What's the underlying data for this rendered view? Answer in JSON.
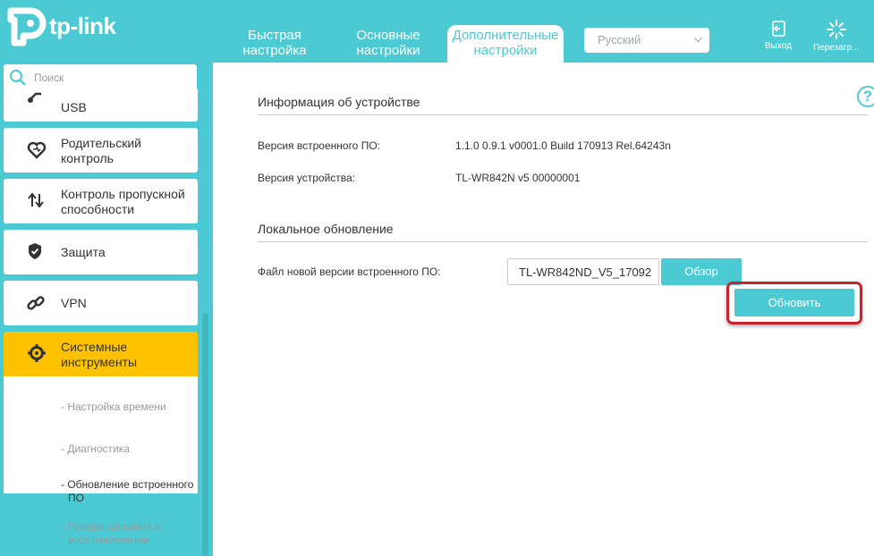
{
  "brand": {
    "logo_text": "tp-link"
  },
  "header": {
    "tabs": [
      {
        "label": "Быстрая настройка",
        "line1": "Быстрая",
        "line2": "настройка",
        "active": false
      },
      {
        "label": "Основные настройки",
        "line1": "Основные",
        "line2": "настройки",
        "active": false
      },
      {
        "label": "Дополнительные настройки",
        "line1": "Дополнительные",
        "line2": "настройки",
        "active": true
      }
    ],
    "language": {
      "selected": "Русский"
    },
    "logout_label": "Выход",
    "reboot_label": "Перезагр...",
    "icons": {
      "logout": "logout-icon",
      "reboot": "reboot-spinner-icon"
    }
  },
  "sidebar": {
    "search_placeholder": "Поиск",
    "items": [
      {
        "label": "USB",
        "icon": "usb-icon"
      },
      {
        "label": "Родительский контроль",
        "line1": "Родительский",
        "line2": "контроль",
        "icon": "heart-icon"
      },
      {
        "label": "Контроль пропускной способности",
        "line1": "Контроль пропускной",
        "line2": "способности",
        "icon": "bandwidth-icon"
      },
      {
        "label": "Защита",
        "icon": "shield-icon"
      },
      {
        "label": "VPN",
        "icon": "link-icon"
      },
      {
        "label": "Системные инструменты",
        "line1": "Системные",
        "line2": "инструменты",
        "icon": "gear-icon",
        "active": true
      }
    ],
    "submenu": [
      {
        "label": "- Настройка времени"
      },
      {
        "label": "- Диагностика"
      },
      {
        "label": "- Обновление встроенного ПО",
        "line1": "- Обновление встроенного",
        "line2": "ПО",
        "current": true
      },
      {
        "label": "- Резервная копия и восстановление",
        "line1": "- Резервная копия и",
        "line2": "восстановление"
      }
    ]
  },
  "main": {
    "help_label": "?",
    "device_info": {
      "title": "Информация об устройстве",
      "firmware_label": "Версия встроенного ПО:",
      "firmware_value": "1.1.0 0.9.1 v0001.0 Build 170913 Rel.64243n",
      "hardware_label": "Версия устройства:",
      "hardware_value": "TL-WR842N v5 00000001"
    },
    "local_update": {
      "title": "Локальное обновление",
      "file_label": "Файл новой версии встроенного ПО:",
      "file_value": "TL-WR842ND_V5_17092",
      "browse_label": "Обзор",
      "update_label": "Обновить"
    }
  },
  "colors": {
    "accent": "#4ccad3",
    "active_menu": "#ffc200",
    "highlight": "#c8232c"
  }
}
